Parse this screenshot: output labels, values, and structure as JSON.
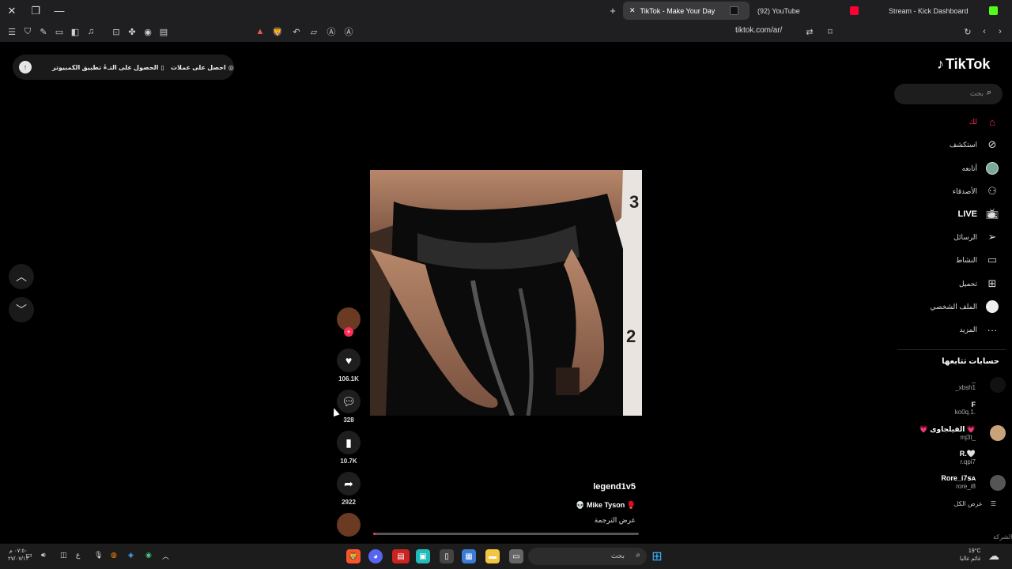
{
  "browser": {
    "tabs": [
      {
        "title": "TikTok - Make Your Day",
        "active": true
      },
      {
        "title": "(92) YouTube",
        "active": false
      },
      {
        "title": "Stream - Kick Dashboard",
        "active": false
      }
    ],
    "url": "tiktok.com/ar/"
  },
  "topbar": {
    "coins": "احصل على عملات",
    "get_app": "الحصول على التـ",
    "desktop_app": "تطبيق الكمبيوتر"
  },
  "sidebar": {
    "logo": "TikTok",
    "search_placeholder": "بحث",
    "items": [
      {
        "label": "لك",
        "icon": "home-icon"
      },
      {
        "label": "استكشف",
        "icon": "compass-icon"
      },
      {
        "label": "أتابعه",
        "icon": "following-icon"
      },
      {
        "label": "الأصدقاء",
        "icon": "friends-icon"
      },
      {
        "label": "LIVE",
        "icon": "live-icon"
      },
      {
        "label": "الرسائل",
        "icon": "messages-icon"
      },
      {
        "label": "النشاط",
        "icon": "activity-icon"
      },
      {
        "label": "تحميل",
        "icon": "upload-icon"
      },
      {
        "label": "الملف الشخصي",
        "icon": "profile-icon"
      },
      {
        "label": "المزيد",
        "icon": "more-icon"
      }
    ],
    "following_title": "حسابات تتابعها",
    "following": [
      {
        "name": "_",
        "user": "_xbsh1"
      },
      {
        "name": "F",
        "user": "ko0q.1."
      },
      {
        "name": "💗 الفيلجاوى 💗",
        "user": "mj3t_"
      },
      {
        "name": "R.🤍",
        "user": "r.qpi7"
      },
      {
        "name": "Rore_i7ꜱᴀ",
        "user": "rore_i8"
      }
    ],
    "show_all": "عرض الكل",
    "footer": "الشركة"
  },
  "video": {
    "username": "legend1v5",
    "description": "💀 Mike Tyson 🥊",
    "translate": "عرض الترجمة",
    "progress": 0.01,
    "likes": "106.1K",
    "comments": "328",
    "saves": "10.7K",
    "shares": "2922"
  },
  "taskbar": {
    "search_placeholder": "بحث",
    "time": "٠٧:٥٠ م",
    "date": "٢٧/٠٧/١٣",
    "temperature": "19°C",
    "weather": "غائم غالبا",
    "lang": "ع"
  },
  "colors": {
    "accent": "#fe2c55",
    "background": "#000000",
    "chrome": "#1f1f21"
  }
}
